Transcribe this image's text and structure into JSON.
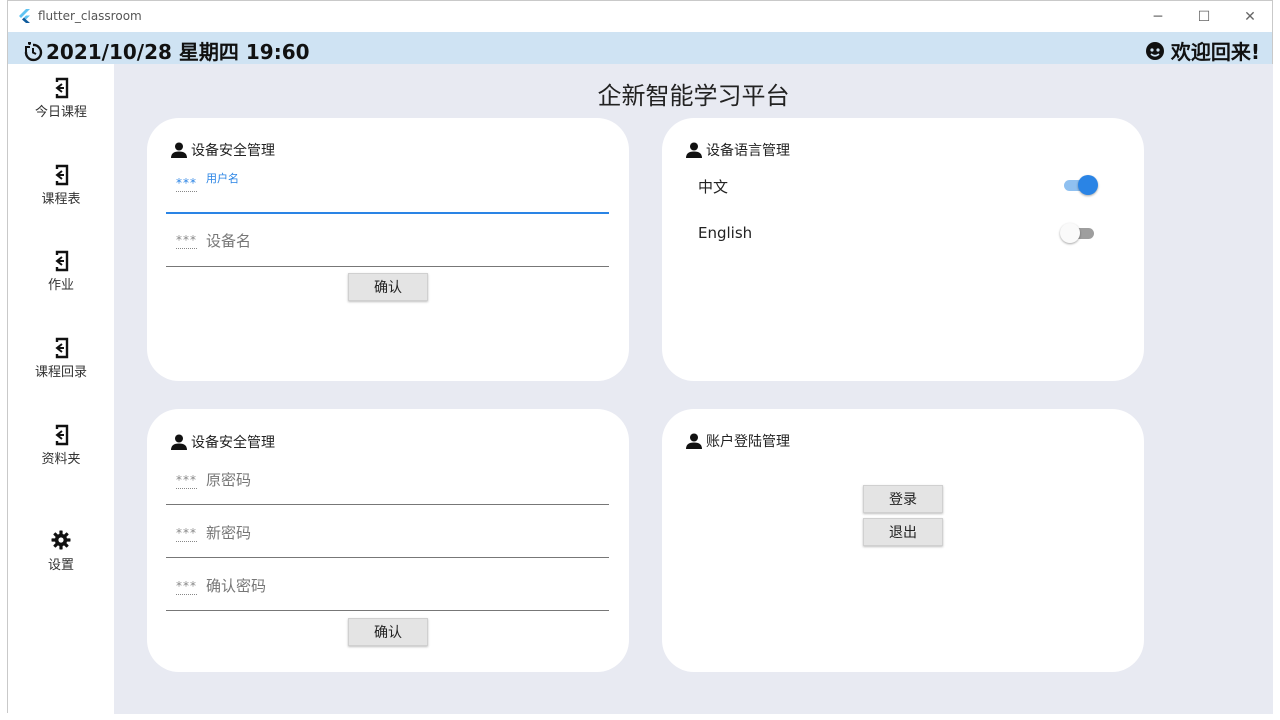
{
  "window": {
    "title": "flutter_classroom",
    "controls": {
      "minimize": "─",
      "maximize": "☐",
      "close": "✕"
    }
  },
  "header": {
    "datetime": "2021/10/28 星期四 19:60",
    "welcome": "欢迎回来!",
    "clock_icon": "clock-icon",
    "user_icon": "user-face-icon"
  },
  "sidebar": {
    "items": [
      {
        "label": "今日课程",
        "icon": "exit-icon"
      },
      {
        "label": "课程表",
        "icon": "exit-icon"
      },
      {
        "label": "作业",
        "icon": "exit-icon"
      },
      {
        "label": "课程回录",
        "icon": "exit-icon"
      },
      {
        "label": "资料夹",
        "icon": "exit-icon"
      },
      {
        "label": "设置",
        "icon": "gear-icon"
      }
    ]
  },
  "main": {
    "title": "企新智能学习平台",
    "device_security": {
      "title": "设备安全管理",
      "username_label": "用户名",
      "devicename_label": "设备名",
      "confirm": "确认"
    },
    "device_language": {
      "title": "设备语言管理",
      "options": [
        {
          "label": "中文",
          "on": true
        },
        {
          "label": "English",
          "on": false
        }
      ]
    },
    "password": {
      "title": "设备安全管理",
      "old_label": "原密码",
      "new_label": "新密码",
      "confirm_label": "确认密码",
      "confirm": "确认"
    },
    "account": {
      "title": "账户登陆管理",
      "login": "登录",
      "logout": "退出"
    },
    "field_prefix": "***"
  },
  "colors": {
    "accent": "#2a84e5",
    "header_bg": "#cfe3f3",
    "content_bg": "#e8eaf2"
  }
}
